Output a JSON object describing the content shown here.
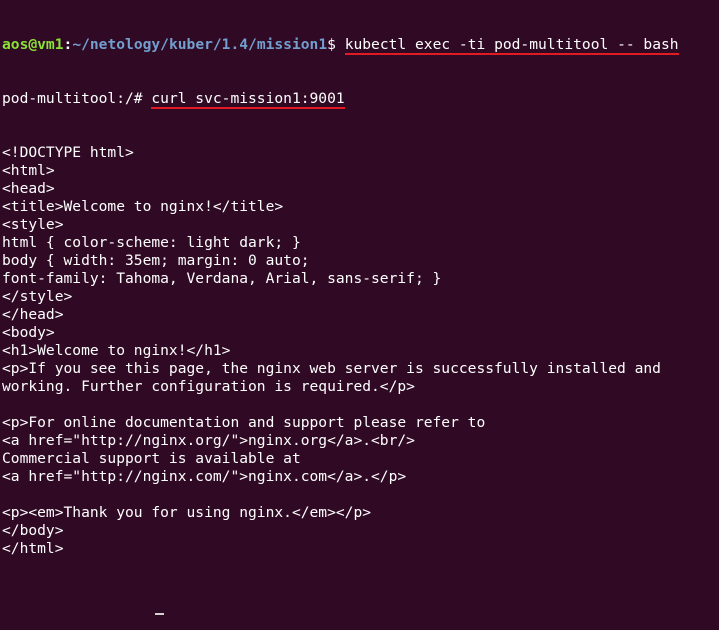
{
  "terminal": {
    "prompt1": {
      "user_host": "aos@vm1",
      "separator": ":",
      "path": "~/netology/kuber/1.4/mission1",
      "dollar": "$ ",
      "command": "kubectl exec -ti pod-multitool -- bash"
    },
    "prompt2": {
      "prefix": "pod-multitool:/# ",
      "command": "curl svc-mission1:9001"
    },
    "output_lines": [
      "<!DOCTYPE html>",
      "<html>",
      "<head>",
      "<title>Welcome to nginx!</title>",
      "<style>",
      "html { color-scheme: light dark; }",
      "body { width: 35em; margin: 0 auto;",
      "font-family: Tahoma, Verdana, Arial, sans-serif; }",
      "</style>",
      "</head>",
      "<body>",
      "<h1>Welcome to nginx!</h1>",
      "<p>If you see this page, the nginx web server is successfully installed and",
      "working. Further configuration is required.</p>",
      "",
      "<p>For online documentation and support please refer to",
      "<a href=\"http://nginx.org/\">nginx.org</a>.<br/>",
      "Commercial support is available at",
      "<a href=\"http://nginx.com/\">nginx.com</a>.</p>",
      "",
      "<p><em>Thank you for using nginx.</em></p>",
      "</body>",
      "</html>"
    ]
  },
  "colors": {
    "background": "#300a24",
    "user_host": "#8ae234",
    "path": "#729fcf",
    "text": "#ffffff",
    "annotation_underline": "#e01b24"
  }
}
